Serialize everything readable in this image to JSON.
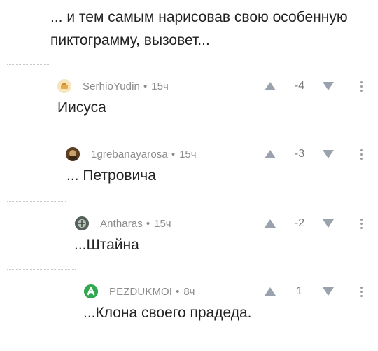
{
  "parent_comment": {
    "text": "... и тем самым нарисовав свою особенную пиктограмму, вызовет..."
  },
  "comments": [
    {
      "author": "SerhioYudin",
      "separator": "•",
      "time": "15ч",
      "score": "-4",
      "body": "Иисуса",
      "avatar_color": "#f3d9a0"
    },
    {
      "author": "1grebanayarosa",
      "separator": "•",
      "time": "15ч",
      "score": "-3",
      "body": "... Петровича",
      "avatar_color": "#6b4a2a"
    },
    {
      "author": "Antharas",
      "separator": "•",
      "time": "15ч",
      "score": "-2",
      "body": "...Штайна",
      "avatar_color": "#7d8a7a"
    },
    {
      "author": "PEZDUKMOI",
      "separator": "•",
      "time": "8ч",
      "score": "1",
      "body": "...Клона своего прадеда.",
      "avatar_color": "#2fa84f"
    }
  ],
  "icons": {
    "upvote": "upvote-arrow-icon",
    "downvote": "downvote-arrow-icon",
    "menu": "more-vertical-icon"
  },
  "colors": {
    "muted_text": "#8c8c8c",
    "vote_arrow": "#9aa3ad",
    "body_text": "#222222",
    "avatar_green": "#2fa84f"
  }
}
